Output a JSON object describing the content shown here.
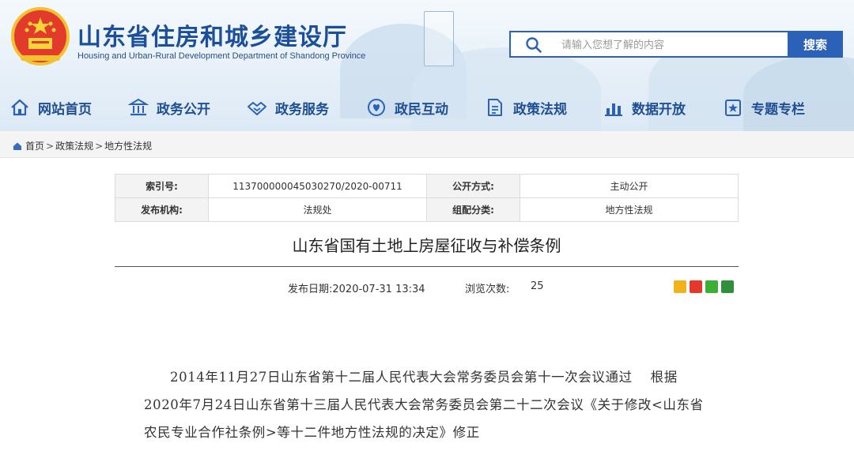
{
  "header": {
    "site_title": "山东省住房和城乡建设厅",
    "site_subtitle": "Housing and Urban-Rural Development Department of Shandong Province",
    "search": {
      "placeholder": "请输入您想了解的内容",
      "button_label": "搜索"
    }
  },
  "nav": [
    {
      "label": "网站首页",
      "icon": "house-icon"
    },
    {
      "label": "政务公开",
      "icon": "building-icon"
    },
    {
      "label": "政务服务",
      "icon": "handshake-icon"
    },
    {
      "label": "政民互动",
      "icon": "heart-hands-icon"
    },
    {
      "label": "政策法规",
      "icon": "document-icon"
    },
    {
      "label": "数据开放",
      "icon": "bar-chart-icon"
    },
    {
      "label": "专题专栏",
      "icon": "topic-icon"
    }
  ],
  "breadcrumb": {
    "items": [
      "首页",
      "政策法规",
      "地方性法规"
    ],
    "separator": ">"
  },
  "info_table": {
    "index_label": "索引号:",
    "index_value": "113700000045030270/2020-00711",
    "open_label": "公开方式:",
    "open_value": "主动公开",
    "org_label": "发布机构:",
    "org_value": "法规处",
    "category_label": "组配分类:",
    "category_value": "地方性法规"
  },
  "article": {
    "title": "山东省国有土地上房屋征收与补偿条例",
    "publish_label": "发布日期:",
    "publish_value": "2020-07-31 13:34",
    "views_label": "浏览次数:",
    "views_value": "25",
    "body": "2014年11月27日山东省第十二届人民代表大会常务委员会第十一次会议通过　 根据2020年7月24日山东省第十三届人民代表大会常务委员会第二十二次会议《关于修改<山东省农民专业合作社条例>等十二件地方性法规的决定》修正"
  },
  "share_icons": [
    "qzone-icon",
    "weibo-icon",
    "wechat-icon",
    "douban-icon"
  ],
  "colors": {
    "brand": "#1b4f9a",
    "search_button": "#2b62b8",
    "nav_text": "#1f4f93"
  }
}
